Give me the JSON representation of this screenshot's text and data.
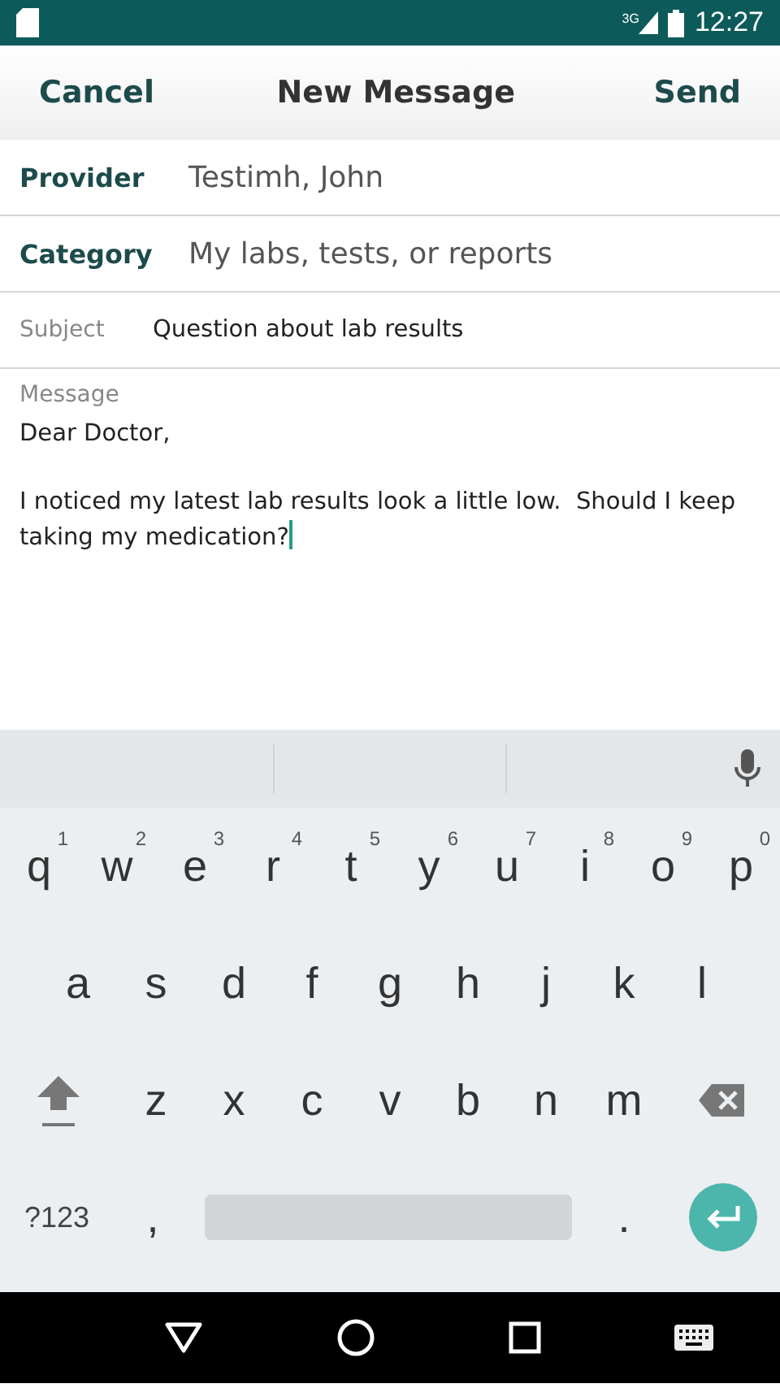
{
  "status_bar": {
    "network": "3G",
    "time": "12:27"
  },
  "header": {
    "cancel": "Cancel",
    "title": "New Message",
    "send": "Send"
  },
  "fields": [
    {
      "kind": "primary",
      "label": "Provider",
      "value": "Testimh, John"
    },
    {
      "kind": "primary",
      "label": "Category",
      "value": "My labs, tests, or reports"
    },
    {
      "kind": "secondary",
      "label": "Subject",
      "value": "Question about lab results"
    }
  ],
  "message": {
    "label": "Message",
    "paragraphs": [
      "Dear Doctor,",
      "I noticed my latest lab results look a little low.  Should I keep taking my medication?"
    ]
  },
  "keyboard": {
    "rows": [
      [
        {
          "label": "q",
          "hint": "1"
        },
        {
          "label": "w",
          "hint": "2"
        },
        {
          "label": "e",
          "hint": "3"
        },
        {
          "label": "r",
          "hint": "4"
        },
        {
          "label": "t",
          "hint": "5"
        },
        {
          "label": "y",
          "hint": "6"
        },
        {
          "label": "u",
          "hint": "7"
        },
        {
          "label": "i",
          "hint": "8"
        },
        {
          "label": "o",
          "hint": "9"
        },
        {
          "label": "p",
          "hint": "0"
        }
      ],
      [
        {
          "label": "a"
        },
        {
          "label": "s"
        },
        {
          "label": "d"
        },
        {
          "label": "f"
        },
        {
          "label": "g"
        },
        {
          "label": "h"
        },
        {
          "label": "j"
        },
        {
          "label": "k"
        },
        {
          "label": "l"
        }
      ],
      [
        {
          "kind": "shift"
        },
        {
          "label": "z"
        },
        {
          "label": "x"
        },
        {
          "label": "c"
        },
        {
          "label": "v"
        },
        {
          "label": "b"
        },
        {
          "label": "n"
        },
        {
          "label": "m"
        },
        {
          "kind": "backspace"
        }
      ]
    ],
    "bottom_row": [
      {
        "kind": "symbols",
        "label": "?123"
      },
      {
        "label": ","
      },
      {
        "kind": "space"
      },
      {
        "label": "."
      },
      {
        "kind": "enter"
      }
    ]
  }
}
